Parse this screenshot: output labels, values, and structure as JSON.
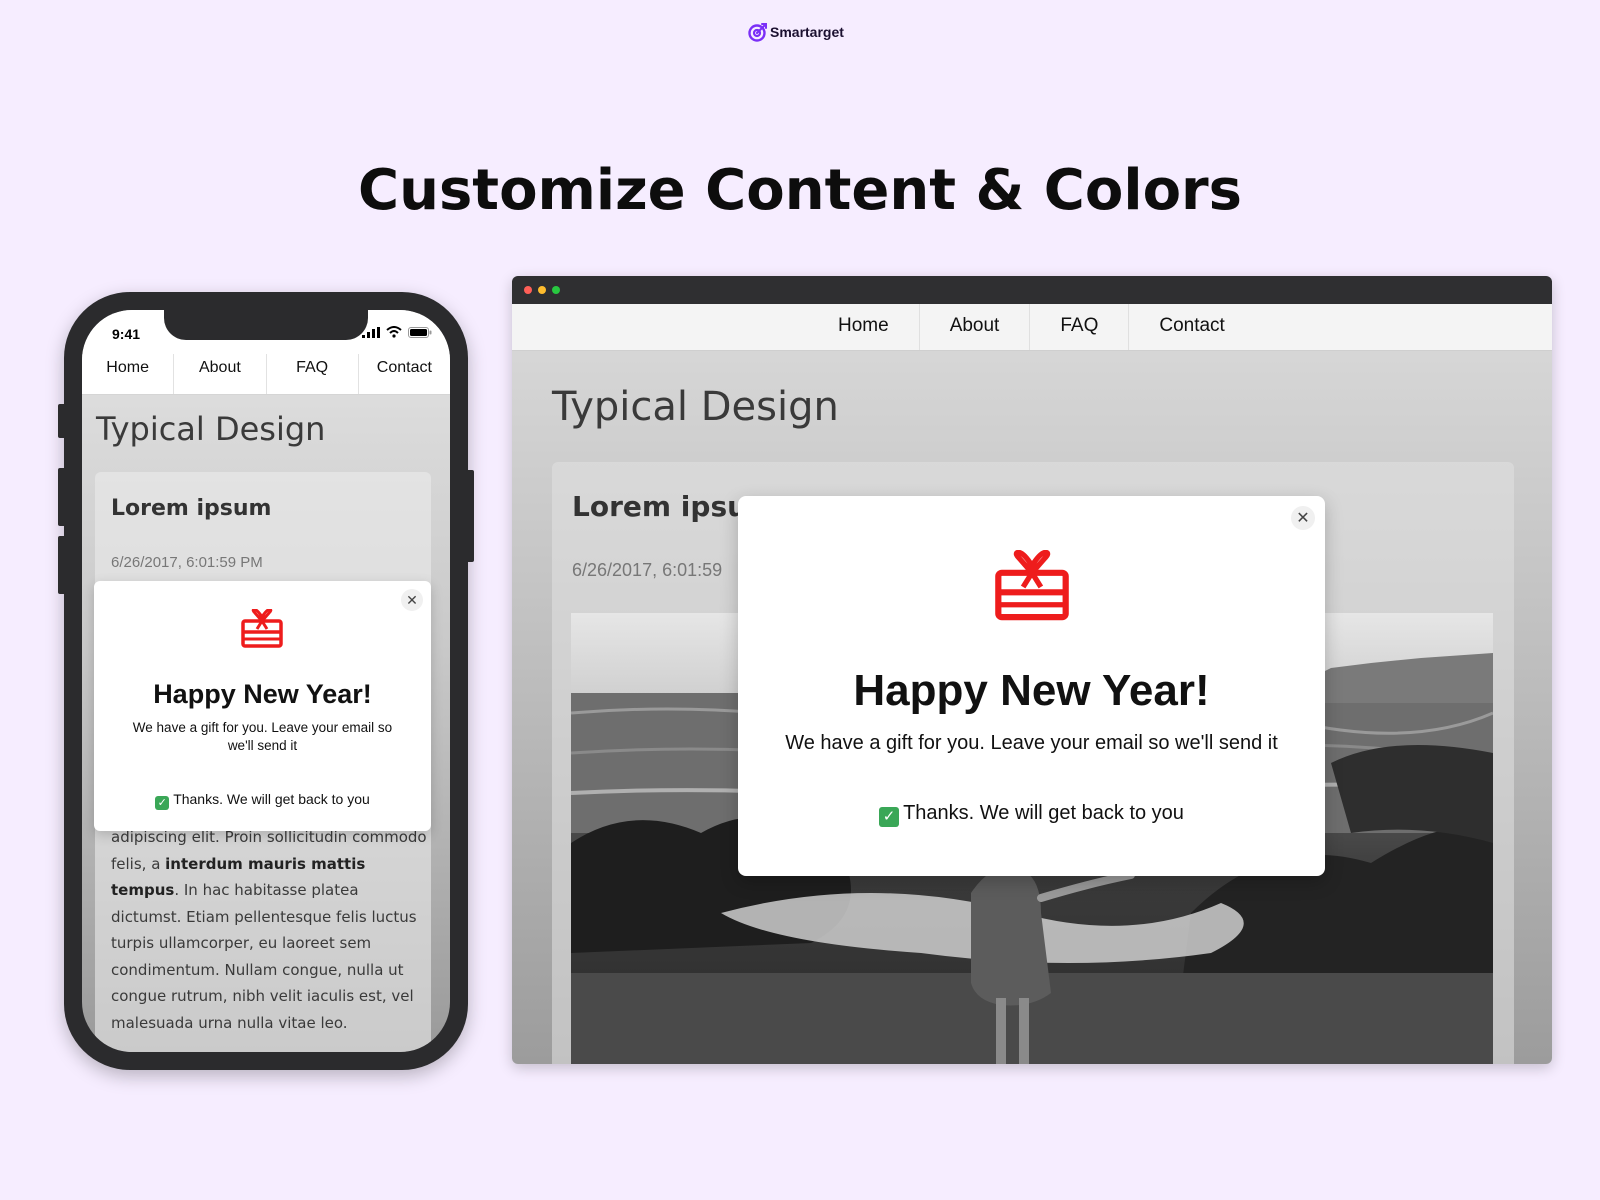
{
  "brand": {
    "name": "Smartarget",
    "color": "#7b2ff7"
  },
  "headline": "Customize Content & Colors",
  "nav": [
    "Home",
    "About",
    "FAQ",
    "Contact"
  ],
  "page": {
    "heading": "Typical Design",
    "card_title": "Lorem ipsum",
    "card_title_browser": "Lorem ipsun",
    "date": "6/26/2017, 6:01:59 PM",
    "date_browser": "6/26/2017, 6:01:59"
  },
  "mobile": {
    "time": "9:41",
    "body_line1": "adipiscing elit. Proin sollicitudin commodo felis, a ",
    "body_bold": "interdum mauris mattis tempus",
    "body_line2": ". In hac habitasse platea dictumst. Etiam pellentesque felis luctus turpis ullamcorper, eu laoreet sem condimentum. Nullam congue, nulla ut congue rutrum, nibh velit iaculis est, vel malesuada urna nulla vitae leo."
  },
  "popup": {
    "title": "Happy New Year!",
    "subtitle": "We have a gift for you. Leave your email so we'll send it",
    "thanks": "Thanks. We will get back to you",
    "close_glyph": "✕",
    "check_glyph": "✓",
    "icon": "gift-icon",
    "icon_color": "#ee1c1c"
  },
  "window_dots": [
    "#ff5f57",
    "#febc2e",
    "#28c840"
  ]
}
